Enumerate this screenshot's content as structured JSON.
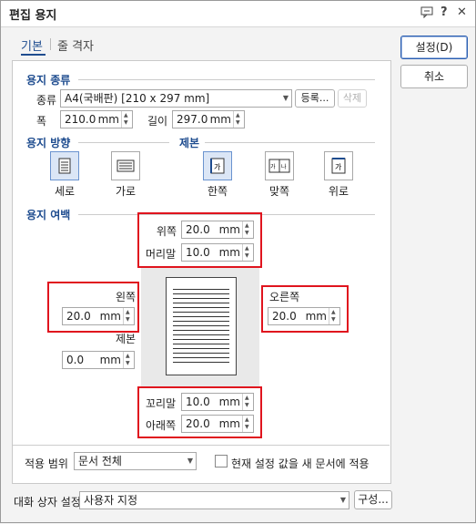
{
  "window": {
    "title": "편집 용지"
  },
  "tabs": [
    {
      "label": "기본"
    },
    {
      "label": "줄 격자"
    }
  ],
  "buttons": {
    "ok": "설정(D)",
    "cancel": "취소",
    "register": "등록...",
    "delete": "삭제",
    "compose": "구성..."
  },
  "paper_type": {
    "heading": "용지 종류",
    "type_label": "종류",
    "type_value": "A4(국배판) [210 x 297 mm]",
    "width_label": "폭",
    "width_value": "210.0",
    "height_label": "길이",
    "height_value": "297.0",
    "unit": "mm"
  },
  "orientation": {
    "heading": "용지 방향",
    "portrait": "세로",
    "landscape": "가로",
    "selected": "세로"
  },
  "binding": {
    "heading": "제본",
    "single": "한쪽",
    "facing": "맞쪽",
    "top": "위로",
    "selected": "한쪽"
  },
  "margins": {
    "heading": "용지 여백",
    "top_label": "위쪽",
    "top_value": "20.0",
    "header_label": "머리말",
    "header_value": "10.0",
    "left_label": "왼쪽",
    "left_value": "20.0",
    "right_label": "오른쪽",
    "right_value": "20.0",
    "gutter_label": "제본",
    "gutter_value": "0.0",
    "footer_label": "꼬리말",
    "footer_value": "10.0",
    "bottom_label": "아래쪽",
    "bottom_value": "20.0",
    "unit": "mm"
  },
  "apply": {
    "label": "적용 범위",
    "value": "문서 전체",
    "checkbox_label": "현재 설정 값을 새 문서에 적용",
    "checked": false
  },
  "dialog_settings": {
    "label": "대화 상자 설정",
    "value": "사용자 지정"
  }
}
